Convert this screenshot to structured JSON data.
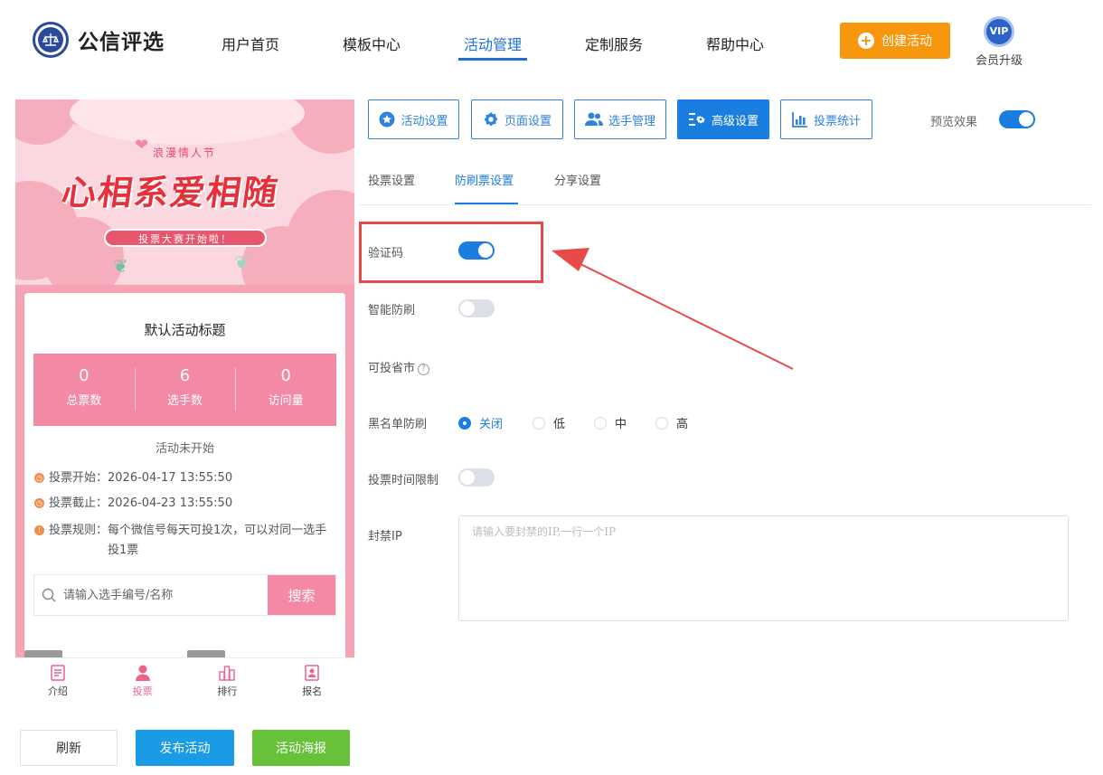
{
  "header": {
    "logo_text": "公信评选",
    "nav": [
      {
        "label": "用户首页",
        "active": false
      },
      {
        "label": "模板中心",
        "active": false
      },
      {
        "label": "活动管理",
        "active": true
      },
      {
        "label": "定制服务",
        "active": false
      },
      {
        "label": "帮助中心",
        "active": false
      }
    ],
    "create_button": "创建活动",
    "vip_badge": "VIP",
    "vip_label": "会员升级"
  },
  "phone": {
    "banner": {
      "small_text": "浪漫情人节",
      "title": "心相系爱相随",
      "pill": "投票大赛开始啦！"
    },
    "card_title": "默认活动标题",
    "stats": [
      {
        "value": "0",
        "label": "总票数"
      },
      {
        "value": "6",
        "label": "选手数"
      },
      {
        "value": "0",
        "label": "访问量"
      }
    ],
    "status": "活动未开始",
    "info": [
      {
        "label": "投票开始：",
        "value": "2026-04-17 13:55:50"
      },
      {
        "label": "投票截止：",
        "value": "2026-04-23 13:55:50"
      },
      {
        "label": "投票规则：",
        "value": "每个微信号每天可投1次，可以对同一选手投1票"
      }
    ],
    "search_placeholder": "请输入选手编号/名称",
    "search_button": "搜索",
    "tabbar": [
      {
        "label": "介绍",
        "icon": "intro-icon",
        "active": false
      },
      {
        "label": "投票",
        "icon": "user-icon",
        "active": true
      },
      {
        "label": "排行",
        "icon": "ranking-icon",
        "active": false
      },
      {
        "label": "报名",
        "icon": "signup-icon",
        "active": false
      }
    ]
  },
  "bottom_buttons": {
    "refresh": "刷新",
    "publish": "发布活动",
    "poster": "活动海报"
  },
  "toolbar": {
    "buttons": [
      {
        "label": "活动设置",
        "icon": "star-icon",
        "active": false
      },
      {
        "label": "页面设置",
        "icon": "gear-icon",
        "active": false
      },
      {
        "label": "选手管理",
        "icon": "users-icon",
        "active": false
      },
      {
        "label": "高级设置",
        "icon": "sliders-icon",
        "active": true
      },
      {
        "label": "投票统计",
        "icon": "bar-chart-icon",
        "active": false
      }
    ],
    "preview_label": "预览效果",
    "preview_on": true
  },
  "subtabs": [
    {
      "label": "投票设置",
      "active": false
    },
    {
      "label": "防刷票设置",
      "active": true
    },
    {
      "label": "分享设置",
      "active": false
    }
  ],
  "settings": {
    "captcha": {
      "label": "验证码",
      "on": true
    },
    "smart_guard": {
      "label": "智能防刷",
      "on": false
    },
    "regions": {
      "label": "可投省市",
      "help": "?"
    },
    "blacklist": {
      "label": "黑名单防刷",
      "options": [
        "关闭",
        "低",
        "中",
        "高"
      ],
      "selected": "关闭"
    },
    "time_limit": {
      "label": "投票时间限制",
      "on": false
    },
    "blocked_ip": {
      "label": "封禁IP",
      "placeholder": "请输入要封禁的IP,一行一个IP"
    }
  },
  "colors": {
    "primary": "#1a7de0",
    "orange": "#f8960d",
    "pink": "#f489a6",
    "green": "#67c23a",
    "annotation_red": "#e84a4a"
  }
}
